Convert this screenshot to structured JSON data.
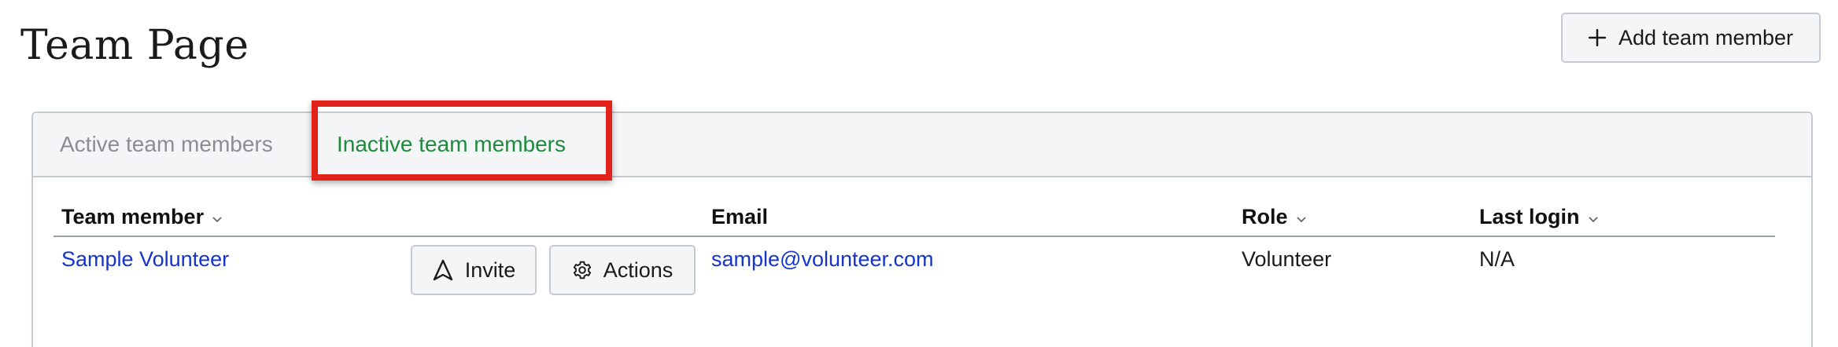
{
  "page": {
    "title": "Team Page"
  },
  "header": {
    "add_button_label": "Add team member",
    "add_icon": "plus-icon"
  },
  "tabs": [
    {
      "label": "Active team members",
      "selected": false
    },
    {
      "label": "Inactive team members",
      "selected": true
    }
  ],
  "table": {
    "columns": [
      {
        "label": "Team member",
        "sortable": true
      },
      {
        "label": "Email",
        "sortable": false
      },
      {
        "label": "Role",
        "sortable": true
      },
      {
        "label": "Last login",
        "sortable": true
      }
    ],
    "rows": [
      {
        "name": "Sample Volunteer",
        "invite_label": "Invite",
        "actions_label": "Actions",
        "email": "sample@volunteer.com",
        "role": "Volunteer",
        "last_login": "N/A"
      }
    ]
  },
  "icons": {
    "sort": "chevron-down-icon",
    "invite": "send-arrow-icon",
    "actions": "gear-icon"
  },
  "colors": {
    "active_tab": "#1e8a3c",
    "inactive_tab": "#8a8d93",
    "link": "#1434cc",
    "highlight": "#e3231b",
    "button_bg": "#f4f5f7",
    "border": "#c6cad1"
  }
}
